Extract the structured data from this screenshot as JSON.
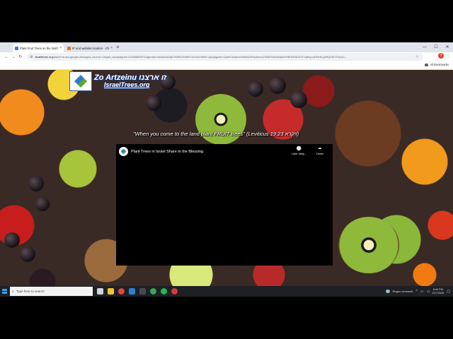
{
  "browser": {
    "tabs": [
      {
        "label": "Plant Fruit Trees on the Northe",
        "favicon_color": "#3a7bd5",
        "active": true
      },
      {
        "label": "IP and website location - Chec",
        "favicon_color": "#e8711a",
        "active": false
      }
    ],
    "new_tab_glyph": "+",
    "window_controls": {
      "minimize": "—",
      "maximize": "☐",
      "close": "✕"
    },
    "nav": {
      "back": "←",
      "forward": "→",
      "reload": "↻"
    },
    "omnibox": {
      "domain": "israeltrees.org",
      "path": "/plant/?a=yw-google-ads&gad_source=1&gad_campaignid=21156880872&gbraid=0AAAAADqE2WWrZSmtRJ1ChVuXMdF-QsQ&gclid=CjwKCAiAmeXNBhA2EiwAmzQ7fN87DkA2Nq0H4RlDkE6G2CFUjNvpuiDHeM-gF6Qr06T57jxoC..."
    },
    "profile_letter": "T",
    "menu_glyph": "⋮",
    "bookmarks": {
      "all_bookmarks_label": "All Bookmarks"
    }
  },
  "page": {
    "logo": {
      "line1": "Zo Artzeinu זו ארצנו",
      "line2": "IsraelTrees.org"
    },
    "verse": "\"When you come to the land plant FRUIT trees\" (Leviticus 19:23 ויקרא)",
    "video": {
      "title": "Plant Trees in Israel Share in the Blessing",
      "watch_later_icon": "clock-icon",
      "watch_later_label": "Later bekij...",
      "share_icon": "share-icon",
      "share_label": "Delen"
    }
  },
  "taskbar": {
    "search_placeholder": "Type here to search",
    "apps": [
      {
        "name": "task-view",
        "color": "#cfd3da"
      },
      {
        "name": "file-explorer",
        "color": "#f2c230"
      },
      {
        "name": "chrome",
        "color": "#e8453c"
      },
      {
        "name": "store",
        "color": "#2d7fd1"
      },
      {
        "name": "terminal",
        "color": "#444a55"
      },
      {
        "name": "chrome-green",
        "color": "#3aa655"
      },
      {
        "name": "spotify",
        "color": "#1db954"
      },
      {
        "name": "app-red",
        "color": "#d23a3a"
      }
    ],
    "weather": "Regen verwacht",
    "time": "8:46 PM",
    "date": "2/27/2026"
  }
}
